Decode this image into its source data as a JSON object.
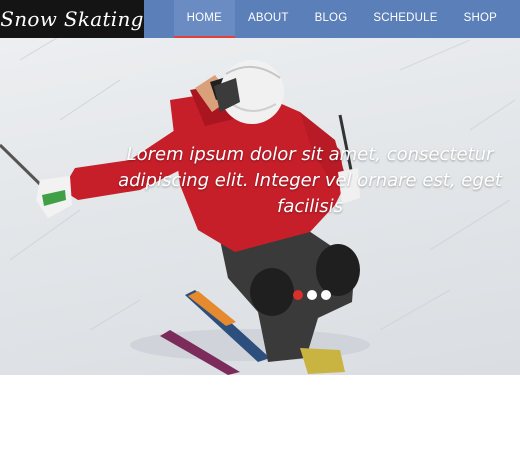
{
  "brand": {
    "logo_text": "Snow Skating"
  },
  "nav": {
    "items": [
      {
        "label": "HOME",
        "active": true
      },
      {
        "label": "ABOUT",
        "active": false
      },
      {
        "label": "BLOG",
        "active": false
      },
      {
        "label": "SCHEDULE",
        "active": false
      },
      {
        "label": "SHOP",
        "active": false
      }
    ]
  },
  "hero": {
    "image_subject": "skier-in-red-jacket",
    "caption": "Lorem ipsum dolor sit amet, consectetur adipiscing elit. Integer vel ornare est, eget facilisis",
    "slides": 3,
    "active_slide": 1
  },
  "colors": {
    "header_bg": "#5b7fb8",
    "logo_bg": "#141414",
    "active_underline": "#e0413a",
    "dot_active": "#d9302b",
    "dot_inactive": "#ffffff"
  }
}
